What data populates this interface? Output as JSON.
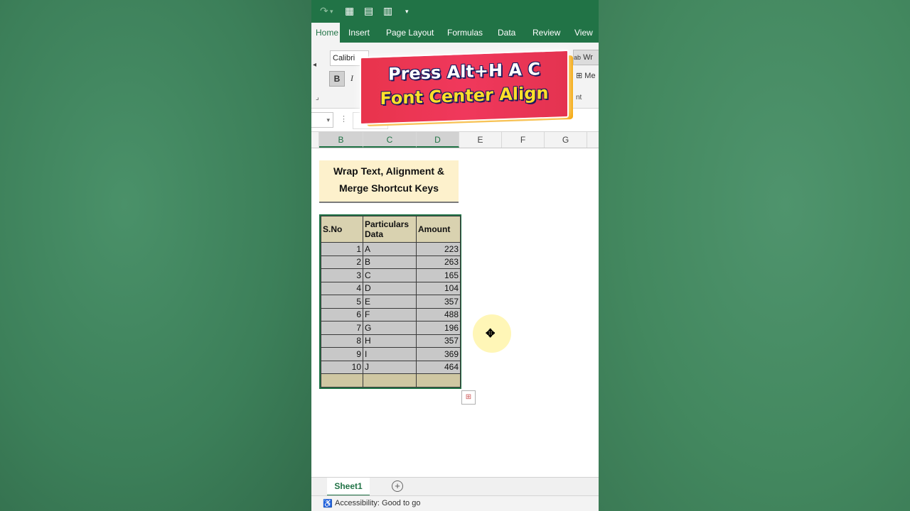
{
  "quick_access": {
    "redo_icon": "redo-icon",
    "form_icon": "form-icon",
    "table_icon": "table-icon",
    "sheet_icon": "sheet-icon",
    "customize_icon": "dropdown-arrow-icon"
  },
  "ribbon_tabs": [
    "Home",
    "Insert",
    "Page Layout",
    "Formulas",
    "Data",
    "Review",
    "View"
  ],
  "active_tab": "Home",
  "ribbon": {
    "font_name": "Calibri",
    "bold_label": "B",
    "italic_label": "I",
    "wrap_label": "Wr",
    "merge_label": "Me",
    "alignment_group_label": "nt"
  },
  "banner": {
    "line1": "Press Alt+H A C",
    "line2": "Font Center Align"
  },
  "columns": [
    "B",
    "C",
    "D",
    "E",
    "F",
    "G"
  ],
  "sheet": {
    "title_line1": "Wrap Text, Alignment &",
    "title_line2": "Merge Shortcut Keys",
    "table": {
      "headers": [
        "S.No",
        "Particulars Data",
        "Amount"
      ],
      "rows": [
        [
          "1",
          "A",
          "223"
        ],
        [
          "2",
          "B",
          "263"
        ],
        [
          "3",
          "C",
          "165"
        ],
        [
          "4",
          "D",
          "104"
        ],
        [
          "5",
          "E",
          "357"
        ],
        [
          "6",
          "F",
          "488"
        ],
        [
          "7",
          "G",
          "196"
        ],
        [
          "8",
          "H",
          "357"
        ],
        [
          "9",
          "I",
          "369"
        ],
        [
          "10",
          "J",
          "464"
        ]
      ]
    }
  },
  "sheet_tabs": {
    "active": "Sheet1",
    "add_label": "+"
  },
  "status": {
    "accessibility": "Accessibility: Good to go"
  },
  "colors": {
    "excel_green": "#217346",
    "banner_red": "#e8344c",
    "banner_yellow": "#ffe02a",
    "title_fill": "#fdf1cc",
    "header_fill": "#d9d2b0",
    "row_fill": "#c8c8c8"
  }
}
